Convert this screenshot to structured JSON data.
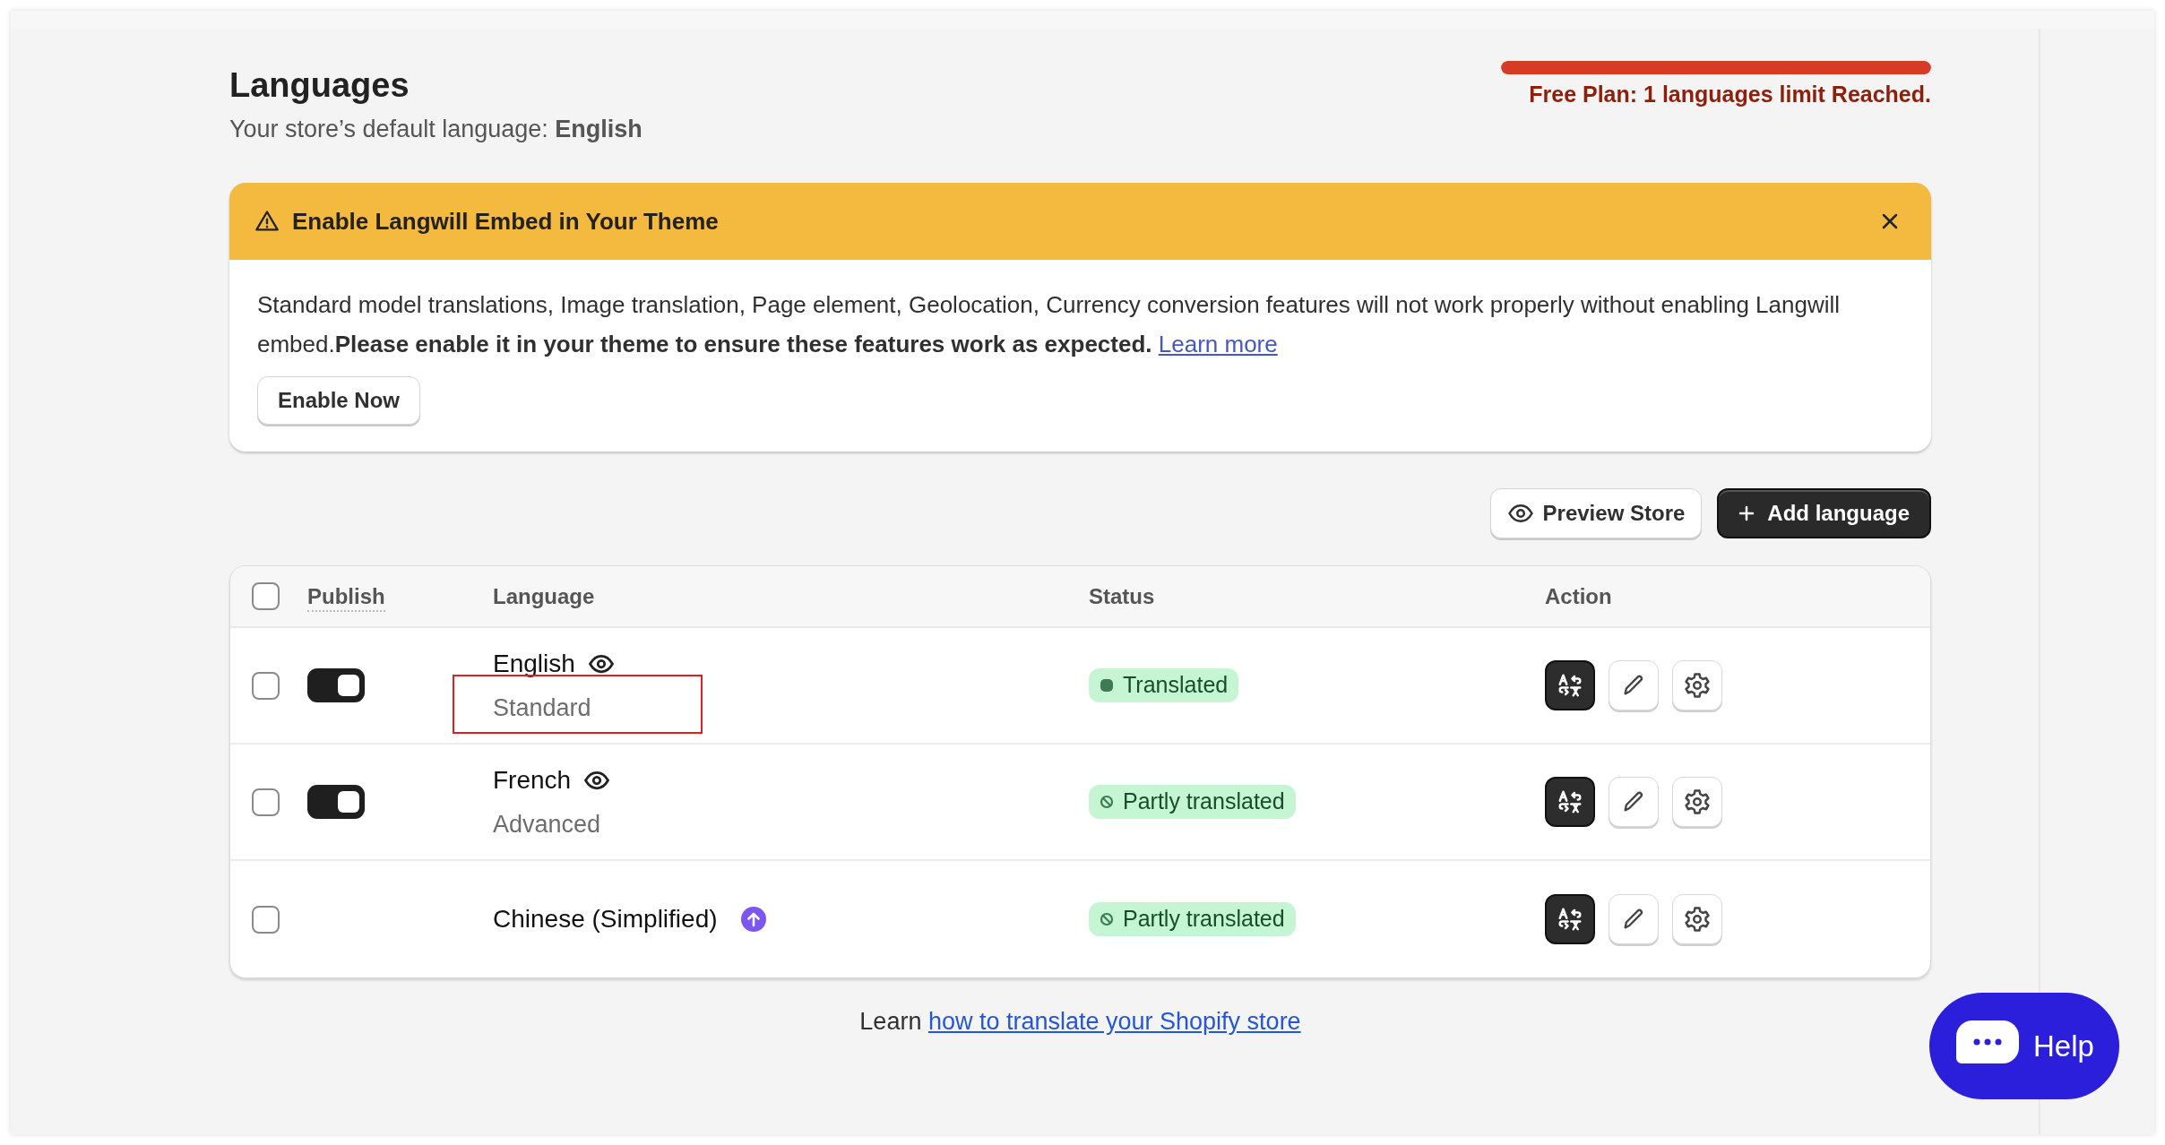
{
  "header": {
    "title": "Languages",
    "subtitle": "Your store’s default language: **English**"
  },
  "plan": {
    "level": 1,
    "message": "Free Plan: 1 languages limit Reached."
  },
  "banner": {
    "title": "Enable Langwill Embed in Your Theme",
    "body": "Standard model translations, Image translation, Page element, Geolocation, Currency conversion features will not work properly without enabling Langwill embed.**Please enable it in your theme to ensure these features work as expected.**",
    "link": "Learn more",
    "button": "Enable Now"
  },
  "actions": [
    "Preview Store",
    "Add language"
  ],
  "table": {
    "select_all": {
      "checked": false
    },
    "columns": [
      "Publish",
      "Language",
      "Status",
      "Action"
    ],
    "rows": [
      {
        "checked": false,
        "kind": "toggle",
        "published": true,
        "language": "English",
        "subtitle": "Standard",
        "highlighted": true,
        "status": {
          "label": "Translated",
          "kind": "full"
        }
      },
      {
        "checked": false,
        "kind": "toggle",
        "published": true,
        "language": "French",
        "subtitle": "Advanced",
        "highlighted": false,
        "status": {
          "label": "Partly translated",
          "kind": "partial"
        }
      },
      {
        "checked": false,
        "kind": "upgrade",
        "language": "Chinese (Simplified)",
        "status": {
          "label": "Partly translated",
          "kind": "partial"
        }
      }
    ]
  },
  "footer": {
    "prefix": "Learn",
    "link": "how to translate your Shopify store"
  },
  "help": {
    "label": "Help"
  }
}
